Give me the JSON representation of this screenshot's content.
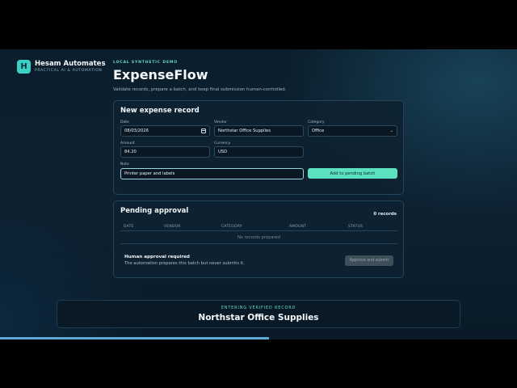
{
  "brand": {
    "badge": "H",
    "name": "Hesam Automates",
    "tagline": "PRACTICAL AI & AUTOMATION"
  },
  "header": {
    "kicker": "LOCAL SYNTHETIC DEMO",
    "title": "ExpenseFlow",
    "subtitle": "Validate records, prepare a batch, and keep final submission human-controlled."
  },
  "form": {
    "title": "New expense record",
    "date": {
      "label": "Date",
      "value": "08/03/2026"
    },
    "vendor": {
      "label": "Vendor",
      "value": "Northstar Office Supplies"
    },
    "category": {
      "label": "Category",
      "value": "Office"
    },
    "amount": {
      "label": "Amount",
      "value": "84.20"
    },
    "currency": {
      "label": "Currency",
      "value": "USD"
    },
    "note": {
      "label": "Note",
      "value": "Printer paper and labels"
    },
    "add_button": "Add to pending batch"
  },
  "pending": {
    "title": "Pending approval",
    "records": "0 records",
    "columns": [
      "DATE",
      "VENDOR",
      "CATEGORY",
      "AMOUNT",
      "STATUS"
    ],
    "empty_text": "No records prepared",
    "approval_title": "Human approval required",
    "approval_sub": "The automation prepares this batch but never submits it.",
    "approve_button": "Approve and submit"
  },
  "banner": {
    "kicker": "ENTERING VERIFIED RECORD",
    "title": "Northstar Office Supplies"
  },
  "progress": {
    "fraction": 0.52
  },
  "colors": {
    "accent": "#5be0c0",
    "background": "#0d2131",
    "progress": "#5fa7d6"
  },
  "icons": {
    "date": "calendar-icon",
    "category": "chevron-down-icon"
  }
}
